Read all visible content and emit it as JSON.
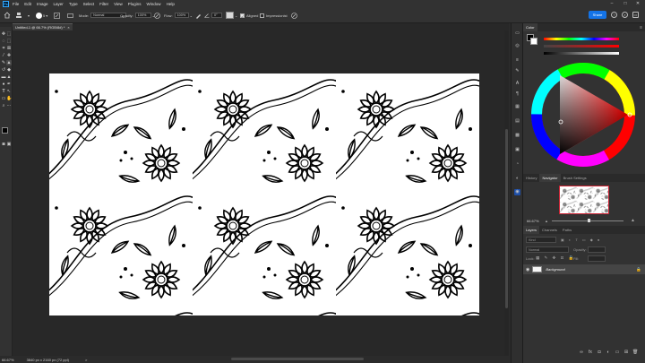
{
  "menubar": {
    "app_logo": "Ps",
    "items": [
      "File",
      "Edit",
      "Image",
      "Layer",
      "Type",
      "Select",
      "Filter",
      "View",
      "Plugins",
      "Window",
      "Help"
    ],
    "window_controls": [
      "–",
      "□",
      "✕"
    ]
  },
  "options": {
    "brush_size": "5",
    "mode_label": "Mode:",
    "mode_value": "Normal",
    "opacity_label": "Opacity:",
    "opacity_value": "100%",
    "flow_label": "Flow:",
    "flow_value": "100%",
    "angle_value": "0°",
    "aligned_label": "Aligned",
    "aligned_checked": true,
    "impressionist_label": "Impressionist",
    "impressionist_checked": false,
    "share_label": "Share"
  },
  "document": {
    "tab_title": "Untitled-1 @ 66.7% (RGB/8#) *",
    "tab_close": "×",
    "zoom": "66.67%",
    "dimensions": "3840 px x 2160 px (72 ppi)",
    "arrow": ">"
  },
  "panels": {
    "color_tab": "Color",
    "history_tab": "History",
    "navigator_tab": "Navigator",
    "brush_settings_tab": "Brush Settings",
    "navigator_zoom": "66.67%",
    "layers_tab": "Layers",
    "channels_tab": "Channels",
    "paths_tab": "Paths",
    "kind_placeholder": "Kind",
    "blend_placeholder": "Normal",
    "opacity_placeholder": "Opacity:",
    "lock_label": "Lock:",
    "fill_placeholder": "Fill:",
    "layer_name": "Background"
  },
  "colors": {
    "accent": "#1473e6",
    "ui_background": "#323232",
    "canvas_background": "#282828",
    "foreground": "#000000",
    "background": "#ffffff"
  }
}
